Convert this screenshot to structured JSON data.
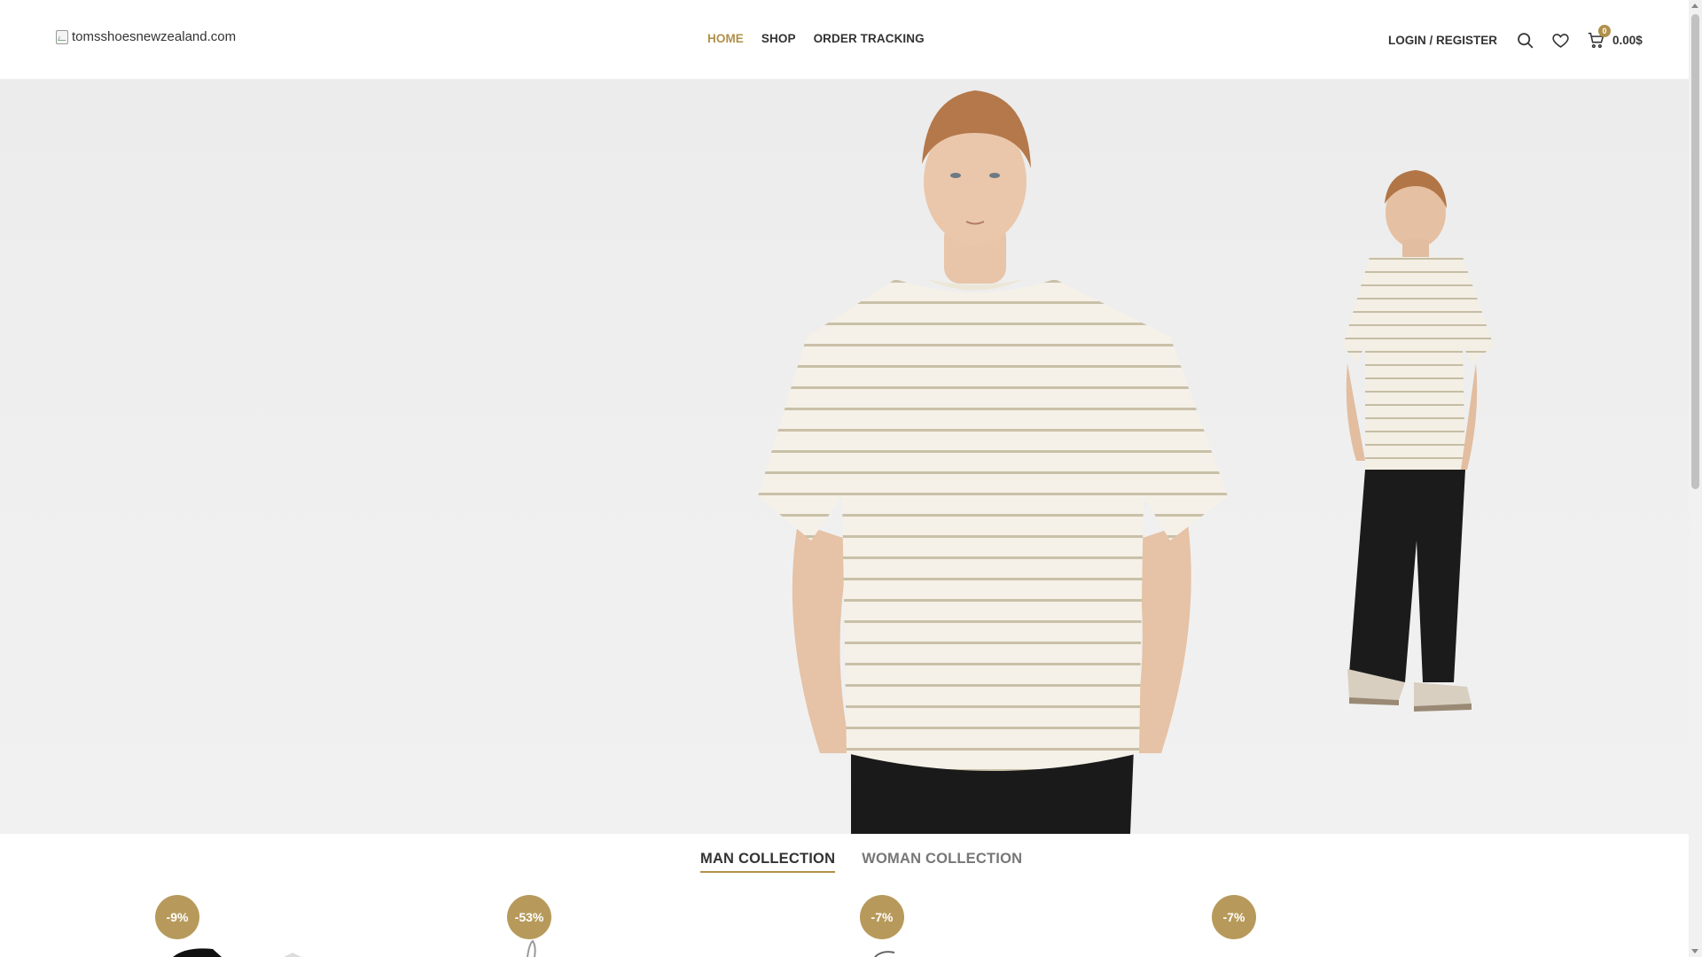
{
  "header": {
    "logo_alt": "tomsshoesnewzealand.com",
    "nav": [
      {
        "label": "HOME",
        "active": true
      },
      {
        "label": "SHOP",
        "active": false
      },
      {
        "label": "ORDER TRACKING",
        "active": false
      }
    ],
    "login_label": "LOGIN / REGISTER",
    "cart_count": "0",
    "cart_total": "0.00$",
    "icons": [
      "search-icon",
      "heart-icon",
      "cart-icon"
    ],
    "accent_color": "#b0904a"
  },
  "hero": {
    "description_icons": [
      "model-front",
      "model-back"
    ]
  },
  "tabs": [
    {
      "label": "MAN COLLECTION",
      "active": true
    },
    {
      "label": "WOMAN COLLECTION",
      "active": false
    }
  ],
  "products": [
    {
      "badge": "-9%"
    },
    {
      "badge": "-53%"
    },
    {
      "badge": "-7%"
    },
    {
      "badge": "-7%"
    }
  ]
}
